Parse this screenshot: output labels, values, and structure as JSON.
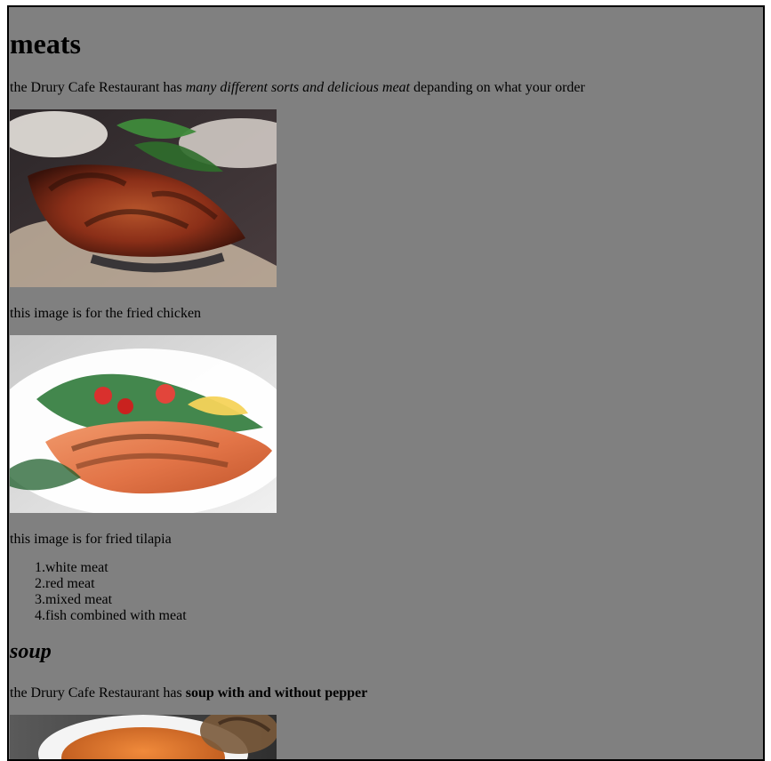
{
  "page": {
    "heading_meats": "meats",
    "meats_intro": {
      "prefix": "the Drury Cafe Restaurant has ",
      "emphasis": "many different sorts and delicious meat",
      "suffix": " depanding on what your order"
    },
    "image1_caption": "this image is for the fried chicken",
    "image2_caption": "this image is for fried tilapia",
    "meat_list": [
      {
        "num": "1.",
        "text": "white meat"
      },
      {
        "num": "2.",
        "text": "red meat"
      },
      {
        "num": "3.",
        "text": "mixed meat"
      },
      {
        "num": "4.",
        "text": "fish combined with meat"
      }
    ],
    "heading_soup": "soup",
    "soup_intro": {
      "prefix": "the Drury Cafe Restaurant has ",
      "strong": "soup with and without pepper"
    }
  },
  "theme": {
    "frame_bg": "#808080",
    "frame_border": "#000000"
  },
  "images": {
    "image1_subject": "grilled-chicken-photo",
    "image2_subject": "grilled-salmon-salad-photo",
    "image3_subject": "soup-and-bread-photo"
  }
}
